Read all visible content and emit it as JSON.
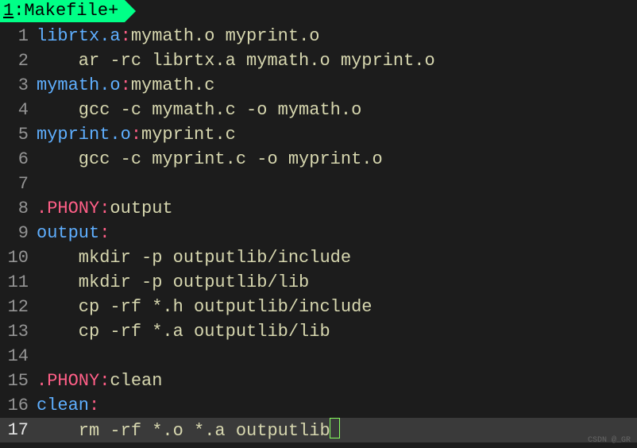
{
  "tab": {
    "number": "1",
    "name": "Makefile",
    "modified": "+"
  },
  "lines": [
    {
      "n": "1",
      "tokens": [
        {
          "cls": "tok-target",
          "t": "librtx.a"
        },
        {
          "cls": "tok-colon",
          "t": ":"
        },
        {
          "cls": "tok-prereq",
          "t": "mymath.o myprint.o"
        }
      ]
    },
    {
      "n": "2",
      "tokens": [
        {
          "cls": "tok-cmd",
          "t": "    ar -rc librtx.a mymath.o myprint.o"
        }
      ]
    },
    {
      "n": "3",
      "tokens": [
        {
          "cls": "tok-target",
          "t": "mymath.o"
        },
        {
          "cls": "tok-colon",
          "t": ":"
        },
        {
          "cls": "tok-prereq",
          "t": "mymath.c"
        }
      ]
    },
    {
      "n": "4",
      "tokens": [
        {
          "cls": "tok-cmd",
          "t": "    gcc -c mymath.c -o mymath.o"
        }
      ]
    },
    {
      "n": "5",
      "tokens": [
        {
          "cls": "tok-target",
          "t": "myprint.o"
        },
        {
          "cls": "tok-colon",
          "t": ":"
        },
        {
          "cls": "tok-prereq",
          "t": "myprint.c"
        }
      ]
    },
    {
      "n": "6",
      "tokens": [
        {
          "cls": "tok-cmd",
          "t": "    gcc -c myprint.c -o myprint.o"
        }
      ]
    },
    {
      "n": "7",
      "tokens": []
    },
    {
      "n": "8",
      "tokens": [
        {
          "cls": "tok-phony",
          "t": ".PHONY"
        },
        {
          "cls": "tok-colon",
          "t": ":"
        },
        {
          "cls": "tok-phonytgt",
          "t": "output"
        }
      ]
    },
    {
      "n": "9",
      "tokens": [
        {
          "cls": "tok-target",
          "t": "output"
        },
        {
          "cls": "tok-colon",
          "t": ":"
        }
      ]
    },
    {
      "n": "10",
      "tokens": [
        {
          "cls": "tok-cmd",
          "t": "    mkdir -p outputlib/include"
        }
      ]
    },
    {
      "n": "11",
      "tokens": [
        {
          "cls": "tok-cmd",
          "t": "    mkdir -p outputlib/lib"
        }
      ]
    },
    {
      "n": "12",
      "tokens": [
        {
          "cls": "tok-cmd",
          "t": "    cp -rf *.h outputlib/include"
        }
      ]
    },
    {
      "n": "13",
      "tokens": [
        {
          "cls": "tok-cmd",
          "t": "    cp -rf *.a outputlib/lib"
        }
      ]
    },
    {
      "n": "14",
      "tokens": []
    },
    {
      "n": "15",
      "tokens": [
        {
          "cls": "tok-phony",
          "t": ".PHONY"
        },
        {
          "cls": "tok-colon",
          "t": ":"
        },
        {
          "cls": "tok-phonytgt",
          "t": "clean"
        }
      ]
    },
    {
      "n": "16",
      "tokens": [
        {
          "cls": "tok-target",
          "t": "clean"
        },
        {
          "cls": "tok-colon",
          "t": ":"
        }
      ]
    },
    {
      "n": "17",
      "tokens": [
        {
          "cls": "tok-cmd",
          "t": "    rm -rf *.o *.a outputlib"
        }
      ],
      "cursor": true,
      "current": true
    }
  ],
  "watermark": "CSDN @_GR"
}
